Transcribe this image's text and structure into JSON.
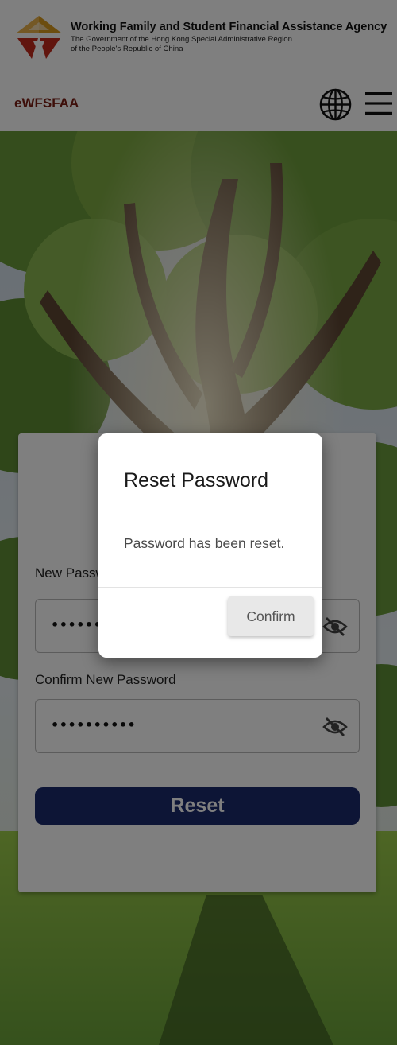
{
  "header": {
    "agency_name": "Working Family and Student Financial Assistance Agency",
    "gov_line_1": "The Government of the Hong Kong Special Administrative Region",
    "gov_line_2": "of the People's Republic of China",
    "nav_title": "eWFSFAA",
    "icons": {
      "language": "globe-icon",
      "menu": "hamburger-menu-icon"
    }
  },
  "form": {
    "new_password_label": "New Password",
    "new_password_value": "••••••••••",
    "confirm_password_label": "Confirm New Password",
    "confirm_password_value": "••••••••••",
    "reset_label": "Reset",
    "icons": {
      "toggle_visibility": "eye-off-icon"
    }
  },
  "dialog": {
    "title": "Reset Password",
    "message": "Password has been reset.",
    "confirm_label": "Confirm"
  },
  "colors": {
    "brand_red": "#7a1d12",
    "reset_button": "#1a2a6c",
    "logo_gold": "#d99a1e",
    "logo_red": "#c22a1c"
  }
}
